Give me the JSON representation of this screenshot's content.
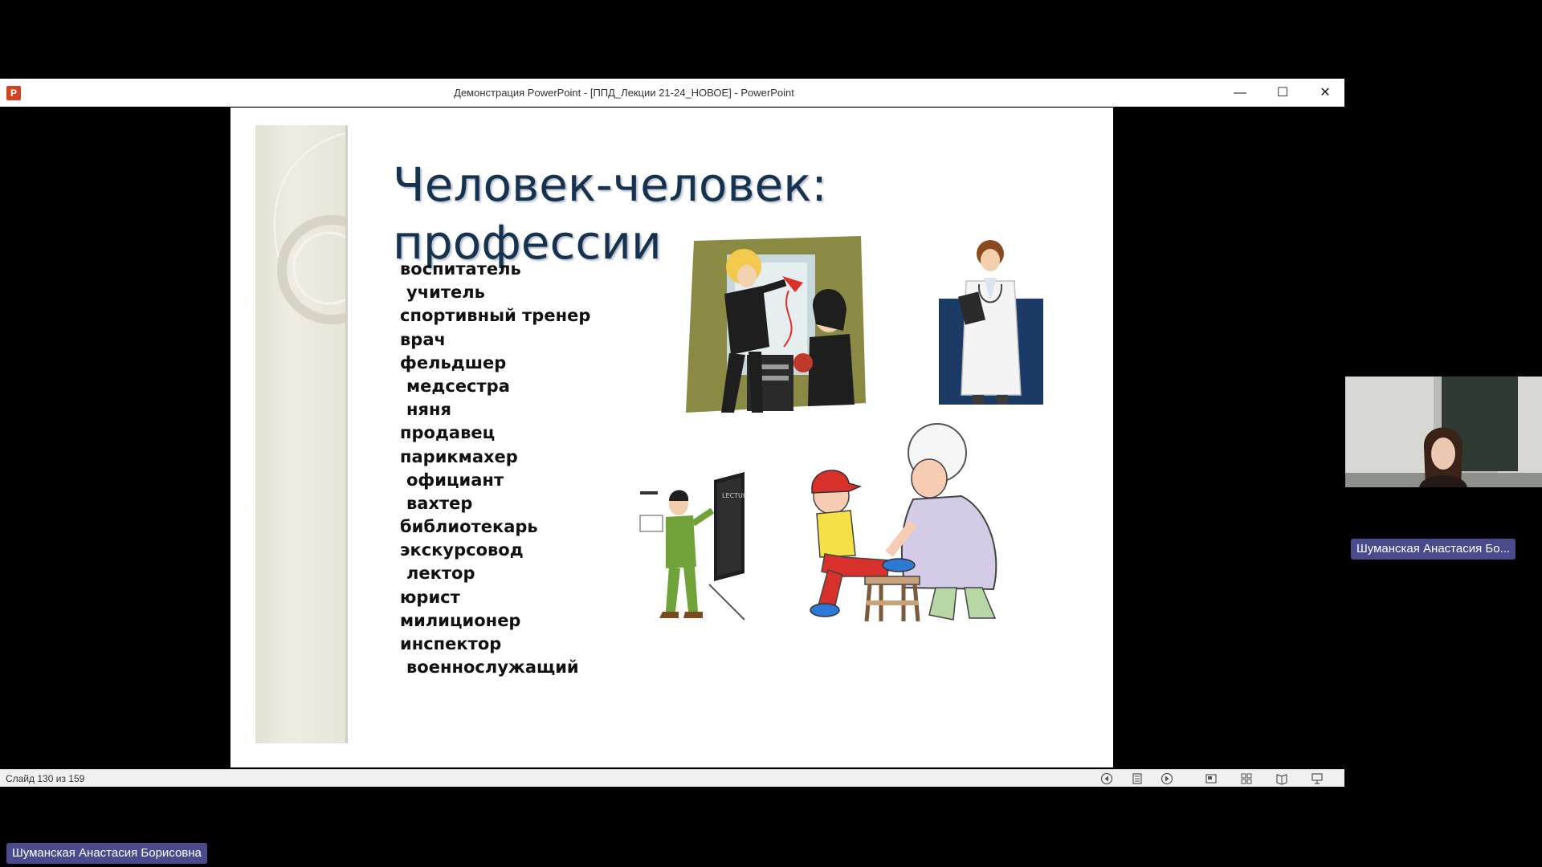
{
  "window": {
    "app_icon_letter": "P",
    "title": "Демонстрация PowerPoint - [ППД_Лекции 21-24_НОВОЕ] - PowerPoint",
    "minimize_glyph": "—",
    "maximize_glyph": "☐",
    "close_glyph": "✕"
  },
  "slide": {
    "title_line1": "Человек-человек:",
    "title_line2": "профессии",
    "professions": [
      "воспитатель",
      "учитель",
      "спортивный тренер",
      "врач",
      "фельдшер",
      "медсестра",
      "няня",
      "продавец",
      "парикмахер",
      "официант",
      "вахтер",
      "библиотекарь",
      "экскурсовод",
      "лектор",
      "юрист",
      "милиционер",
      "инспектор",
      "военнослужащий"
    ],
    "illustrations": [
      "hairdresser-clipart",
      "doctor-clipart",
      "lecturer-clipart",
      "nurse-helping-boy-clipart"
    ]
  },
  "statusbar": {
    "slide_counter": "Слайд 130 из 159",
    "icons": [
      "previous-icon",
      "notes-icon",
      "next-icon",
      "normal-view-icon",
      "slide-sorter-icon",
      "reading-view-icon",
      "slideshow-icon"
    ]
  },
  "participants": {
    "video_name": "Шуманская Анастасия Бо...",
    "main_name": "Шуманская Анастасия Борисовна"
  },
  "colors": {
    "background": "#000000",
    "title_text": "#16324e",
    "name_tag": "#4a4b8c",
    "ppt_brand": "#d04423"
  }
}
